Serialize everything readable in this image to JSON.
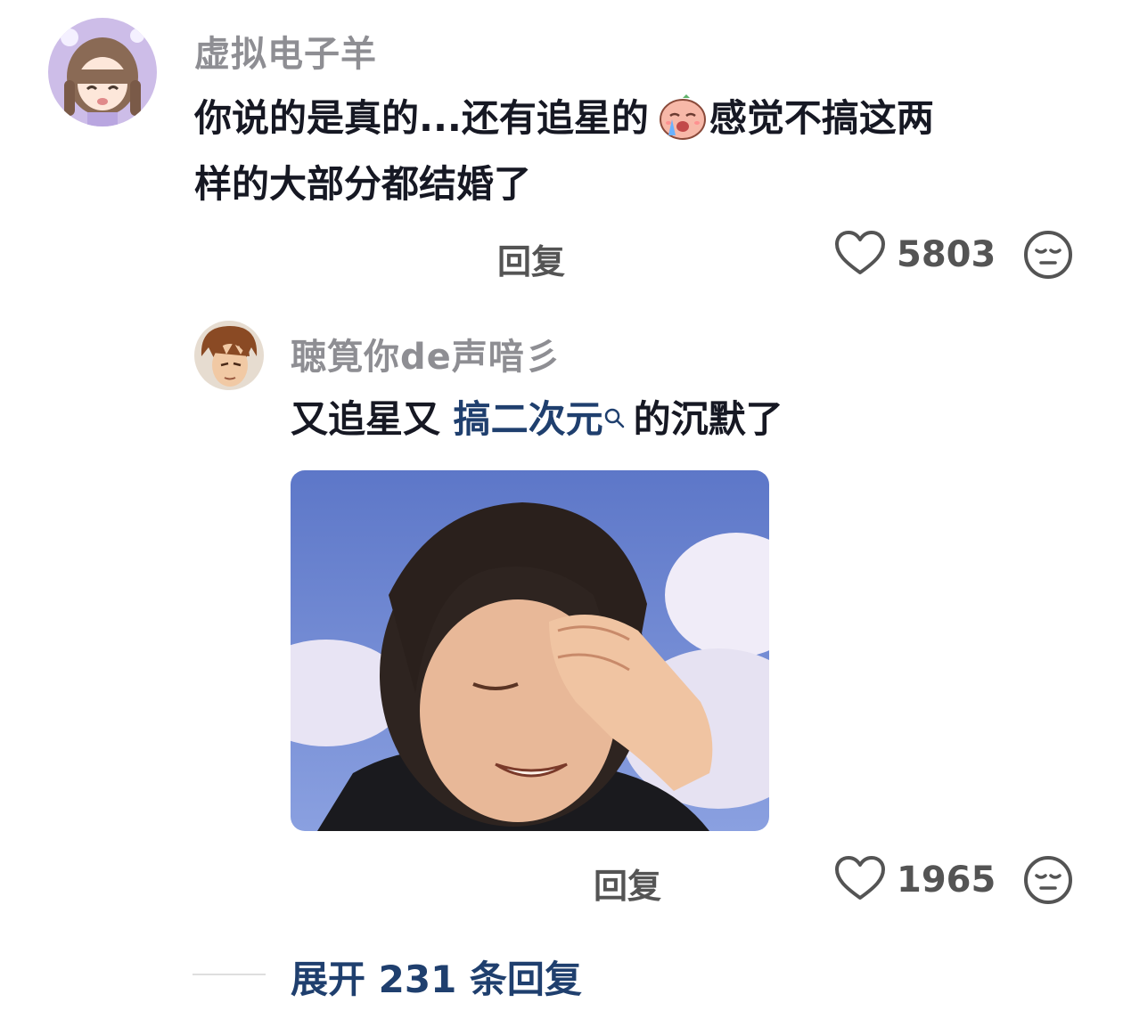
{
  "comment": {
    "username": "虚拟电子羊",
    "text_part1": "你说的是真的...还有追星的",
    "emoji": "crying-face-emoji",
    "text_part2": "感觉不搞这两",
    "text_line2": "样的大部分都结婚了",
    "reply_label": "回复",
    "like_count": "5803"
  },
  "reply": {
    "username": "聴筧你de声喑彡",
    "text_before": "又追星又",
    "link_text": "搞二次元",
    "text_after": "的沉默了",
    "image": "facepalm-meme-photo",
    "reply_label": "回复",
    "like_count": "1965"
  },
  "expand": {
    "label": "展开 231 条回复"
  },
  "colors": {
    "username": "#8e8e93",
    "text": "#161823",
    "link": "#1f3f6e",
    "meta": "#545454"
  }
}
